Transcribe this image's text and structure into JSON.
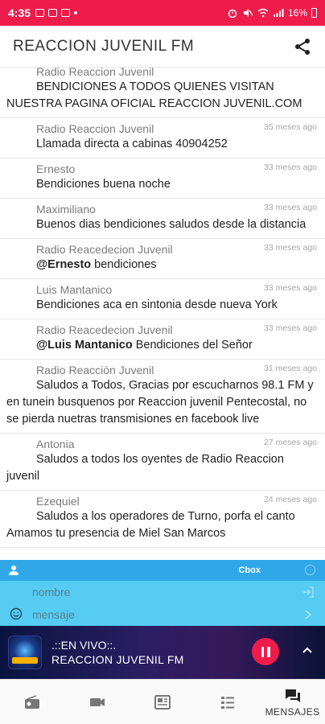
{
  "status_bar": {
    "time": "4:35",
    "battery": "16%"
  },
  "app_bar": {
    "title": "REACCION JUVENIL FM"
  },
  "messages": [
    {
      "author": "Radio Reaccion Juvenil",
      "when": "",
      "mention": "",
      "text": "BENDICIONES A TODOS QUIENES VISITAN NUESTRA PAGINA OFICIAL REACCION JUVENIL.COM"
    },
    {
      "author": "Radio Reaccion Juvenil",
      "when": "35 meses ago",
      "mention": "",
      "text": "Llamada directa a cabinas 40904252"
    },
    {
      "author": "Ernesto",
      "when": "33 meses ago",
      "mention": "",
      "text": "Bendiciones buena noche"
    },
    {
      "author": "Maximiliano",
      "when": "33 meses ago",
      "mention": "",
      "text": "Buenos dias bendiciones saludos desde la distancia"
    },
    {
      "author": "Radio Reacedecion Juvenil",
      "when": "33 meses ago",
      "mention": "@Ernesto",
      "text": " bendiciones"
    },
    {
      "author": "Luis Mantanico",
      "when": "33 meses ago",
      "mention": "",
      "text": "Bendiciones aca en sintonia desde nueva York"
    },
    {
      "author": "Radio Reacedecion Juvenil",
      "when": "33 meses ago",
      "mention": "@Luis Mantanico",
      "text": " Bendiciones del Señor"
    },
    {
      "author": "Radio Reacción Juvenil",
      "when": "31 meses ago",
      "mention": "",
      "text": "Saludos a Todos, Gracias por escucharnos 98.1 FM y en tunein busquenos por Reaccion juvenil Pentecostal, no se pierda nuetras transmisiones en facebook live"
    },
    {
      "author": "Antonia",
      "when": "27 meses ago",
      "mention": "",
      "text": "Saludos a todos los oyentes de Radio Reaccion juvenil"
    },
    {
      "author": "Ezequiel",
      "when": "24 meses ago",
      "mention": "",
      "text": "Saludos a los operadores de Turno, porfa el canto Amamos tu presencia de Miel San Marcos"
    }
  ],
  "cbox": {
    "label": "Cbox",
    "name_placeholder": "nombre",
    "message_placeholder": "mensaje"
  },
  "player": {
    "live_label": ".::EN VIVO::.",
    "station": "REACCION JUVENIL FM"
  },
  "bottom_nav": {
    "active_label": "MENSAJES"
  },
  "colors": {
    "accent": "#ee1c4b",
    "cbox_bar": "#30a8e8",
    "cbox_inputs": "#56ccf2"
  }
}
